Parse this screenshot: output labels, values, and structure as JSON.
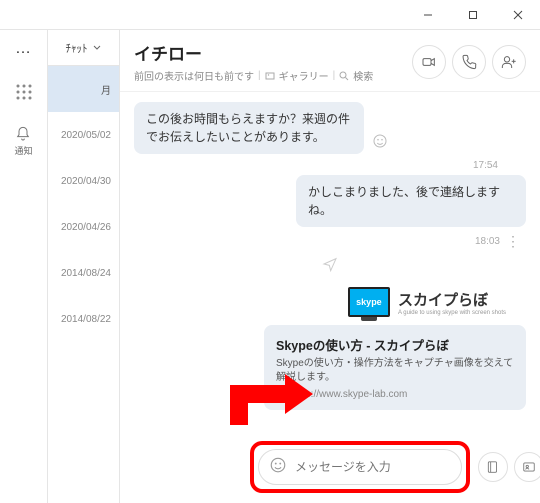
{
  "titlebar": {
    "min": "—",
    "max": "☐",
    "close": "✕"
  },
  "col1": {
    "more": "…",
    "bell_label": "通知"
  },
  "col2": {
    "head_label": "ﾁｬｯﾄ",
    "items": [
      {
        "label": "月",
        "selected": true
      },
      {
        "label": "2020/05/02",
        "selected": false
      },
      {
        "label": "2020/04/30",
        "selected": false
      },
      {
        "label": "2020/04/26",
        "selected": false
      },
      {
        "label": "2014/08/24",
        "selected": false
      },
      {
        "label": "2014/08/22",
        "selected": false
      }
    ]
  },
  "header": {
    "contact_name": "イチロー",
    "last_seen": "前回の表示は何日も前です",
    "gallery": "ギャラリー",
    "search": "検索"
  },
  "chat": {
    "msg1": "この後お時間もらえますか？来週の件でお伝えしたいことがあります。",
    "ts1": "17:54",
    "msg2": "かしこまりました、後で連絡しますね。",
    "ts2": "18:03",
    "skypelab_logo": "skype",
    "skypelab_title": "スカイプらぼ",
    "skypelab_sub": "A guide to using skype with screen shots",
    "card_title": "Skypeの使い方 - スカイプらぼ",
    "card_desc": "Skypeの使い方・操作方法をキャプチャ画像を交えて解説します。",
    "card_url": "https://www.skype-lab.com"
  },
  "composer": {
    "placeholder": "メッセージを入力"
  }
}
